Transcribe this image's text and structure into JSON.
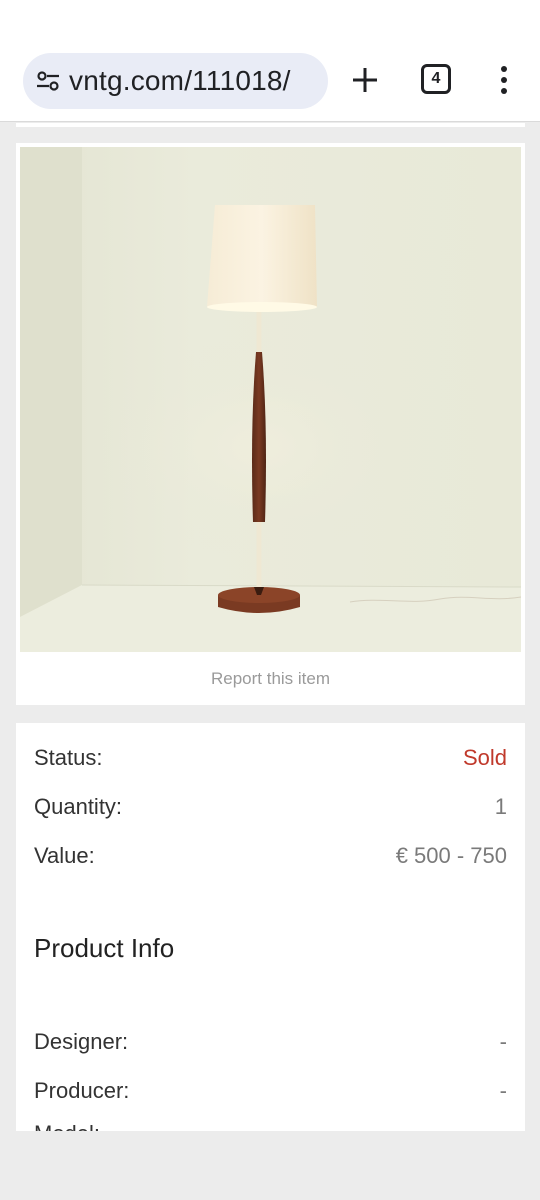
{
  "browser": {
    "url": "vntg.com/111018/",
    "tab_count": "4"
  },
  "item": {
    "report_label": "Report this item"
  },
  "details": {
    "status_label": "Status:",
    "status_value": "Sold",
    "quantity_label": "Quantity:",
    "quantity_value": "1",
    "value_label": "Value:",
    "value_value": "€ 500 - 750"
  },
  "product_info": {
    "title": "Product Info",
    "designer_label": "Designer:",
    "designer_value": "-",
    "producer_label": "Producer:",
    "producer_value": "-",
    "model_label": "Model:"
  },
  "colors": {
    "sold": "#c0392b",
    "omnibox_bg": "#e9ecf6"
  }
}
